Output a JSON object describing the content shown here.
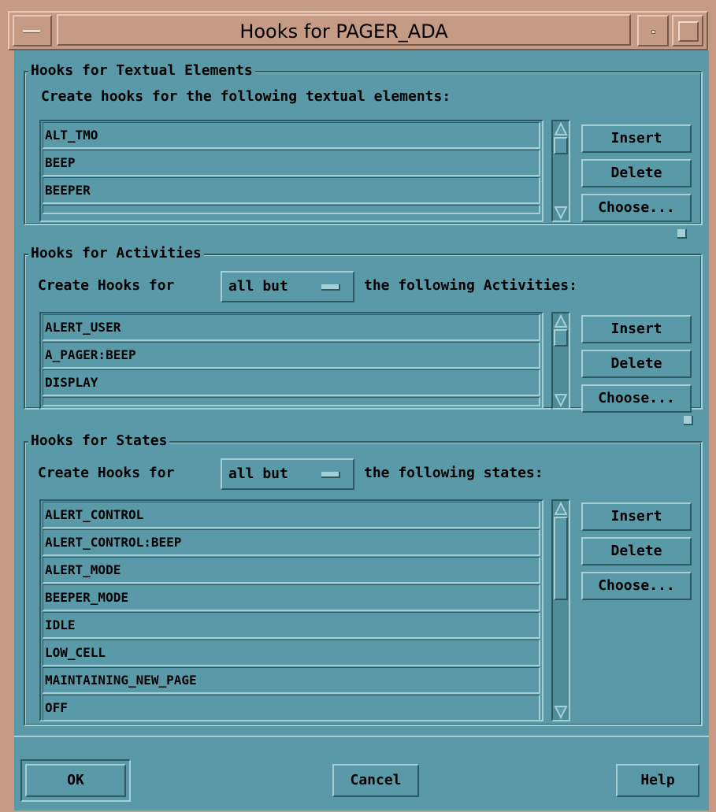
{
  "window": {
    "title": "Hooks for PAGER_ADA"
  },
  "textual": {
    "legend": "Hooks for Textual Elements",
    "prompt": "Create hooks for the following textual elements:",
    "items": [
      "ALT_TMO",
      "BEEP",
      "BEEPER"
    ],
    "buttons": {
      "insert": "Insert",
      "delete": "Delete",
      "choose": "Choose..."
    }
  },
  "activities": {
    "legend": "Hooks for Activities",
    "prompt_prefix": "Create Hooks for",
    "option_value": "all but",
    "prompt_suffix": "the following Activities:",
    "items": [
      "ALERT_USER",
      "A_PAGER:BEEP",
      "DISPLAY"
    ],
    "buttons": {
      "insert": "Insert",
      "delete": "Delete",
      "choose": "Choose..."
    }
  },
  "states": {
    "legend": "Hooks for States",
    "prompt_prefix": "Create Hooks for",
    "option_value": "all but",
    "prompt_suffix": "the following states:",
    "items": [
      "ALERT_CONTROL",
      "ALERT_CONTROL:BEEP",
      "ALERT_MODE",
      "BEEPER_MODE",
      "IDLE",
      "LOW_CELL",
      "MAINTAINING_NEW_PAGE",
      "OFF"
    ],
    "buttons": {
      "insert": "Insert",
      "delete": "Delete",
      "choose": "Choose..."
    }
  },
  "dialog_buttons": {
    "ok": "OK",
    "cancel": "Cancel",
    "help": "Help"
  },
  "colors": {
    "background": "#5a9aa8",
    "frame": "#c59b86",
    "shadow": "#2b5a64",
    "highlight": "#a6d0d8"
  },
  "icons": [
    "window-menu-icon",
    "minimize-icon",
    "maximize-icon",
    "scroll-up-arrow-icon",
    "scroll-down-arrow-icon",
    "option-menu-indicator-icon",
    "pane-sash-icon"
  ]
}
